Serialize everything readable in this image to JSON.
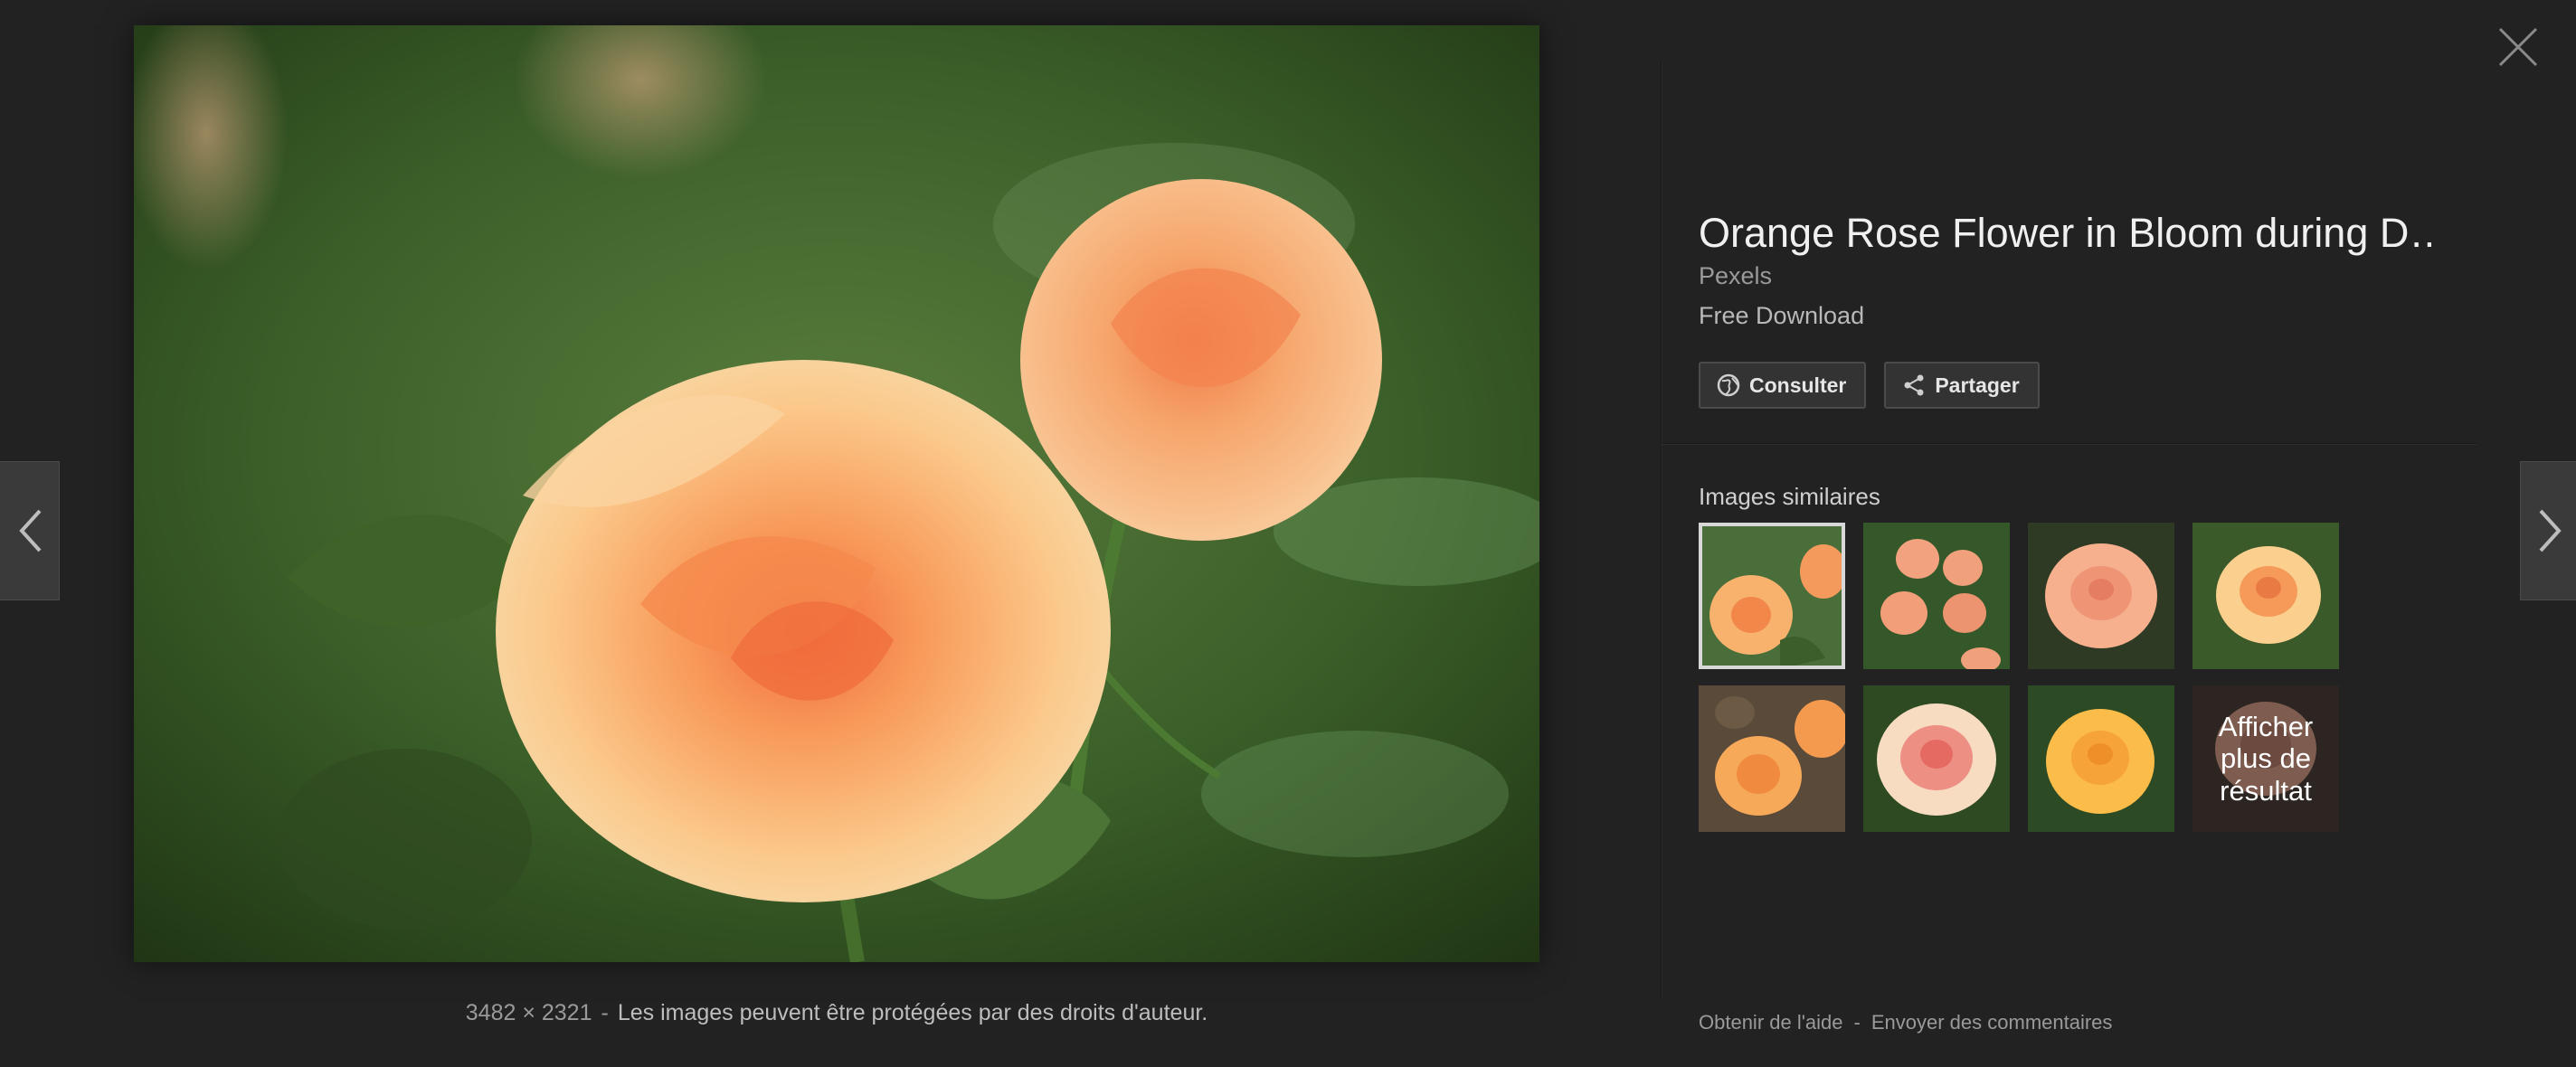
{
  "main_image": {
    "alt": "Orange rose flowers in bloom"
  },
  "caption": {
    "dimensions": "3482 × 2321",
    "separator": "-",
    "copyright_notice": "Les images peuvent être protégées par des droits d'auteur."
  },
  "nav": {
    "prev_icon": "chevron-left-icon",
    "next_icon": "chevron-right-icon",
    "close_icon": "close-icon"
  },
  "panel": {
    "title": "Orange Rose Flower in Bloom during D…",
    "source": "Pexels",
    "description": "Free Download",
    "actions": {
      "visit_label": "Consulter",
      "share_label": "Partager"
    },
    "similar_title": "Images similaires",
    "more_results_label": "Afficher plus de résultat",
    "footer": {
      "help_label": "Obtenir de l'aide",
      "separator": "-",
      "feedback_label": "Envoyer des commentaires"
    }
  },
  "colors": {
    "background": "#222222",
    "panel_text": "#f0f0f0",
    "muted_text": "#9a9a9a",
    "button_bg": "#333333",
    "rose_orange": "#f6a65c",
    "leaf_green": "#3e6a2c"
  }
}
